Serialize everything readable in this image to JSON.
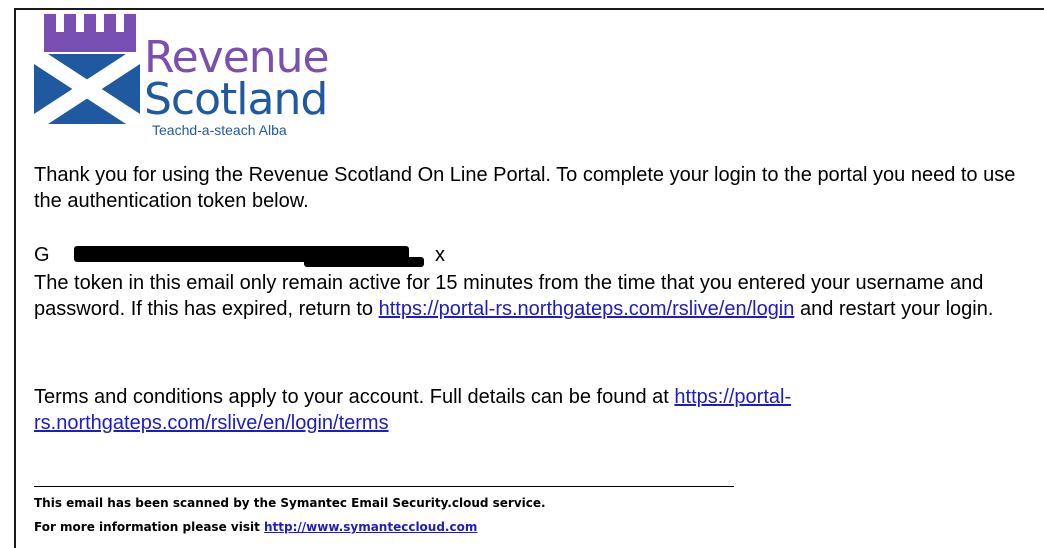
{
  "logo": {
    "line1": "Revenue",
    "line2": "Scotland",
    "tagline": "Teachd-a-steach Alba",
    "colors": {
      "purple": "#7a4fb4",
      "blue": "#1f5aa0"
    }
  },
  "email": {
    "intro": "Thank you for using the Revenue Scotland On Line Portal. To complete your login to the portal you need to use the authentication token below.",
    "token_visible_start": "G",
    "token_visible_end": "x",
    "expiry_text": "The token in this email only remain active for 15 minutes from the time that you entered your username and password. If this has expired, return to",
    "login_link": "https://portal-rs.northgateps.com/rslive/en/login",
    "expiry_tail": "and restart your login.",
    "terms_text": "Terms and conditions apply to your account. Full details can be found at",
    "terms_link": "https://portal-rs.northgateps.com/rslive/en/login/terms"
  },
  "footer": {
    "scanned": "This email has been scanned by the Symantec Email Security.cloud service.",
    "more_info": "For more information please visit",
    "link": "http://www.symanteccloud.com"
  },
  "colors": {
    "link": "#1c1cc8"
  }
}
